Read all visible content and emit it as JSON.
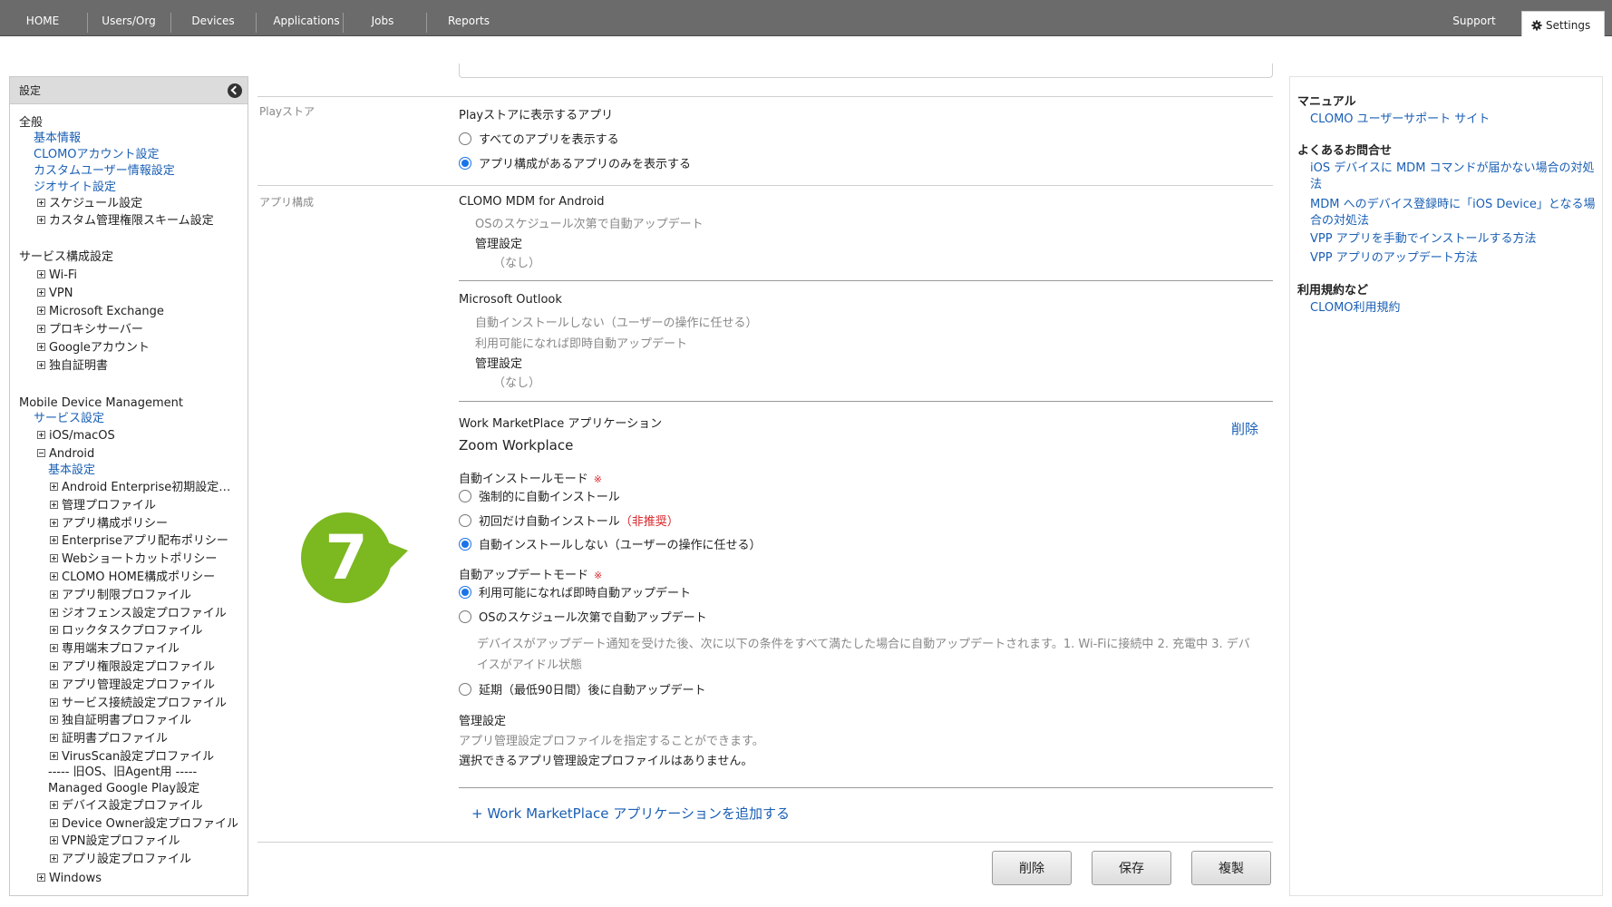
{
  "topnav": {
    "tabs": [
      "HOME",
      "Users/Org",
      "Devices",
      "Applications",
      "Jobs",
      "Reports"
    ],
    "support": "Support",
    "settings": "Settings"
  },
  "sidebar": {
    "header": "設定",
    "general": {
      "title": "全般",
      "items": [
        "基本情報",
        "CLOMOアカウント設定",
        "カスタムユーザー情報設定",
        "ジオサイト設定",
        "スケジュール設定",
        "カスタム管理権限スキーム設定"
      ]
    },
    "service_config": {
      "title": "サービス構成設定",
      "items": [
        "Wi-Fi",
        "VPN",
        "Microsoft Exchange",
        "プロキシサーバー",
        "Googleアカウント",
        "独自証明書"
      ]
    },
    "mdm": {
      "title": "Mobile Device Management",
      "service_settings": "サービス設定",
      "ios": "iOS/macOS",
      "android": "Android",
      "android_basic": "基本設定",
      "android_items": [
        "Android Enterprise初期設定…",
        "管理プロファイル",
        "アプリ構成ポリシー",
        "Enterpriseアプリ配布ポリシー",
        "Webショートカットポリシー",
        "CLOMO HOME構成ポリシー",
        "アプリ制限プロファイル",
        "ジオフェンス設定プロファイル",
        "ロックタスクプロファイル",
        "専用端末プロファイル",
        "アプリ権限設定プロファイル",
        "アプリ管理設定プロファイル",
        "サービス接続設定プロファイル",
        "独自証明書プロファイル",
        "証明書プロファイル",
        "VirusScan設定プロファイル"
      ],
      "legacy_label": "----- 旧OS、旧Agent用 -----",
      "managed_play": "Managed Google Play設定",
      "legacy_items": [
        "デバイス設定プロファイル",
        "Device Owner設定プロファイル",
        "VPN設定プロファイル",
        "アプリ設定プロファイル"
      ],
      "windows": "Windows"
    }
  },
  "main": {
    "playstore": {
      "label": "Playストア",
      "title": "Playストアに表示するアプリ",
      "options": [
        "すべてのアプリを表示する",
        "アプリ構成があるアプリのみを表示する"
      ],
      "selected": 1
    },
    "app_config": {
      "label": "アプリ構成",
      "apps": [
        {
          "name": "CLOMO MDM for Android",
          "lines": [
            "OSのスケジュール次第で自動アップデート"
          ],
          "mgmt_label": "管理設定",
          "mgmt_value": "（なし）"
        },
        {
          "name": "Microsoft Outlook",
          "lines": [
            "自動インストールしない（ユーザーの操作に任せる）",
            "利用可能になれば即時自動アップデート"
          ],
          "mgmt_label": "管理設定",
          "mgmt_value": "（なし）"
        }
      ],
      "work": {
        "header": "Work MarketPlace アプリケーション",
        "delete": "削除",
        "app_name": "Zoom Workplace",
        "install_mode_label": "自動インストールモード",
        "required_mark": "※",
        "install_options": [
          "強制的に自動インストール",
          "初回だけ自動インストール",
          "自動インストールしない（ユーザーの操作に任せる）"
        ],
        "not_recommended": "（非推奨）",
        "install_selected": 2,
        "update_mode_label": "自動アップデートモード",
        "update_options": [
          "利用可能になれば即時自動アップデート",
          "OSのスケジュール次第で自動アップデート",
          "延期（最低90日間）後に自動アップデート"
        ],
        "update_selected": 0,
        "update_note_1": "デバイスがアップデート通知を受けた後、次に以下の条件をすべて満たした場合に自動アップデートされます。1. Wi-Fiに接続中 2. 充電中 3. デバ",
        "update_note_2": "イスがアイドル状態",
        "mgmt_label": "管理設定",
        "mgmt_hint": "アプリ管理設定プロファイルを指定することができます。",
        "mgmt_none": "選択できるアプリ管理設定プロファイルはありません。"
      },
      "add_link": "+ Work MarketPlace アプリケーションを追加する"
    },
    "buttons": {
      "delete": "削除",
      "save": "保存",
      "duplicate": "複製"
    },
    "step_badge": "7",
    "badge_color": "#7cb820"
  },
  "right": {
    "manual_title": "マニュアル",
    "manual_link": "CLOMO ユーザーサポート サイト",
    "faq_title": "よくあるお問合せ",
    "faq_links": [
      "iOS デバイスに MDM コマンドが届かない場合の対処法",
      "MDM へのデバイス登録時に「iOS Device」となる場合の対処法",
      "VPP アプリを手動でインストールする方法",
      "VPP アプリのアップデート方法"
    ],
    "terms_title": "利用規約など",
    "terms_link": "CLOMO利用規約"
  }
}
